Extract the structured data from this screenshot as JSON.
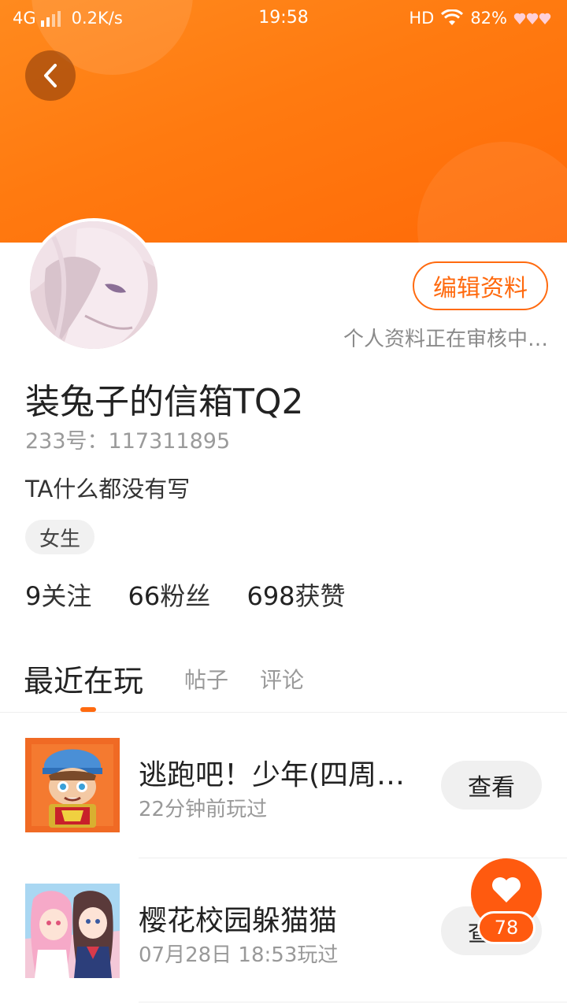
{
  "status_bar": {
    "network": "4G",
    "speed": "0.2K/s",
    "time": "19:58",
    "hd": "HD",
    "battery": "82%",
    "signal_icon": "signal-icon",
    "wifi_icon": "wifi-icon",
    "battery_icon": "hearts-battery-icon"
  },
  "header": {
    "back_icon": "chevron-left-icon",
    "banner_color": "#ff7a10"
  },
  "profile": {
    "edit_label": "编辑资料",
    "review_note": "个人资料正在审核中…",
    "nickname": "装兔子的信箱TQ2",
    "uid": "233号：117311895",
    "bio": "TA什么都没有写",
    "gender": "女生",
    "stats": [
      {
        "num": "9",
        "label": "关注"
      },
      {
        "num": "66",
        "label": "粉丝"
      },
      {
        "num": "698",
        "label": "获赞"
      }
    ]
  },
  "tabs": {
    "active": "最近在玩",
    "posts": "帖子",
    "comments": "评论"
  },
  "games": [
    {
      "title": "逃跑吧！少年(四周…",
      "time": "22分钟前玩过",
      "button": "查看"
    },
    {
      "title": "樱花校园躲猫猫",
      "time": "07月28日 18:53玩过",
      "button": "查看"
    }
  ],
  "like_fab": {
    "icon": "heart-icon",
    "count": "78"
  },
  "accent_color": "#ff6a0f"
}
